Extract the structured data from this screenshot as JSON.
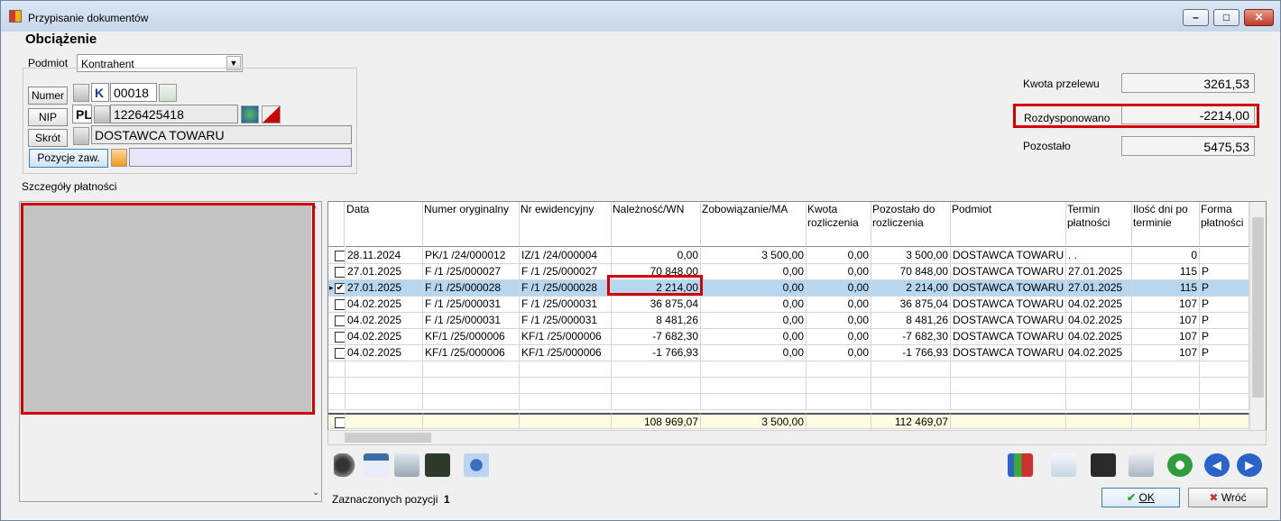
{
  "window": {
    "title": "Przypisanie dokumentów"
  },
  "heading": "Obciążenie",
  "podmiot": {
    "label": "Podmiot",
    "value": "Kontrahent"
  },
  "left_form": {
    "numer_button": "Numer",
    "numer_prefix": "K",
    "numer_value": "00018",
    "nip_button": "NIP",
    "nip_prefix": "PL",
    "nip_value": "1226425418",
    "skrot_button": "Skrót",
    "skrot_value": "DOSTAWCA TOWARU",
    "pozycje_button": "Pozycje zaw.",
    "pozycje_value": ""
  },
  "totals": {
    "kwota_label": "Kwota przelewu",
    "kwota_value": "3261,53",
    "rozdysp_label": "Rozdysponowano",
    "rozdysp_value": "-2214,00",
    "pozostalo_label": "Pozostało",
    "pozostalo_value": "5475,53"
  },
  "details_label": "Szczegóły płatności",
  "grid": {
    "columns": [
      "Data",
      "Numer oryginalny",
      "Nr ewidencyjny",
      "Należność/WN",
      "Zobowiązanie/MA",
      "Kwota\nrozliczenia",
      "Pozostało do\nrozliczenia",
      "Podmiot",
      "Termin\npłatności",
      "Ilość dni po\nterminie",
      "Forma\npłatności"
    ],
    "rows": [
      {
        "checked": false,
        "selected": false,
        "cells": [
          "28.11.2024",
          "PK/1 /24/000012",
          "IZ/1 /24/000004",
          "0,00",
          "3 500,00",
          "0,00",
          "3 500,00",
          "DOSTAWCA TOWARU",
          ". .",
          "0",
          ""
        ]
      },
      {
        "checked": false,
        "selected": false,
        "cells": [
          "27.01.2025",
          "F /1 /25/000027",
          "F /1 /25/000027",
          "70 848,00",
          "0,00",
          "0,00",
          "70 848,00",
          "DOSTAWCA TOWARU",
          "27.01.2025",
          "115",
          "P"
        ]
      },
      {
        "checked": true,
        "selected": true,
        "cells": [
          "27.01.2025",
          "F /1 /25/000028",
          "F /1 /25/000028",
          "2 214,00",
          "0,00",
          "0,00",
          "2 214,00",
          "DOSTAWCA TOWARU",
          "27.01.2025",
          "115",
          "P"
        ]
      },
      {
        "checked": false,
        "selected": false,
        "cells": [
          "04.02.2025",
          "F /1 /25/000031",
          "F /1 /25/000031",
          "36 875,04",
          "0,00",
          "0,00",
          "36 875,04",
          "DOSTAWCA TOWARU",
          "04.02.2025",
          "107",
          "P"
        ]
      },
      {
        "checked": false,
        "selected": false,
        "cells": [
          "04.02.2025",
          "F /1 /25/000031",
          "F /1 /25/000031",
          "8 481,26",
          "0,00",
          "0,00",
          "8 481,26",
          "DOSTAWCA TOWARU",
          "04.02.2025",
          "107",
          "P"
        ]
      },
      {
        "checked": false,
        "selected": false,
        "cells": [
          "04.02.2025",
          "KF/1 /25/000006",
          "KF/1 /25/000006",
          "-7 682,30",
          "0,00",
          "0,00",
          "-7 682,30",
          "DOSTAWCA TOWARU",
          "04.02.2025",
          "107",
          "P"
        ]
      },
      {
        "checked": false,
        "selected": false,
        "cells": [
          "04.02.2025",
          "KF/1 /25/000006",
          "KF/1 /25/000006",
          "-1 766,93",
          "0,00",
          "0,00",
          "-1 766,93",
          "DOSTAWCA TOWARU",
          "04.02.2025",
          "107",
          "P"
        ]
      }
    ],
    "footer": [
      "",
      "",
      "",
      "108 969,07",
      "3 500,00",
      "",
      "112 469,07",
      "",
      "",
      "",
      ""
    ]
  },
  "status": {
    "label": "Zaznaczonych pozycji",
    "count": "1"
  },
  "buttons": {
    "ok": "OK",
    "back": "Wróć"
  }
}
